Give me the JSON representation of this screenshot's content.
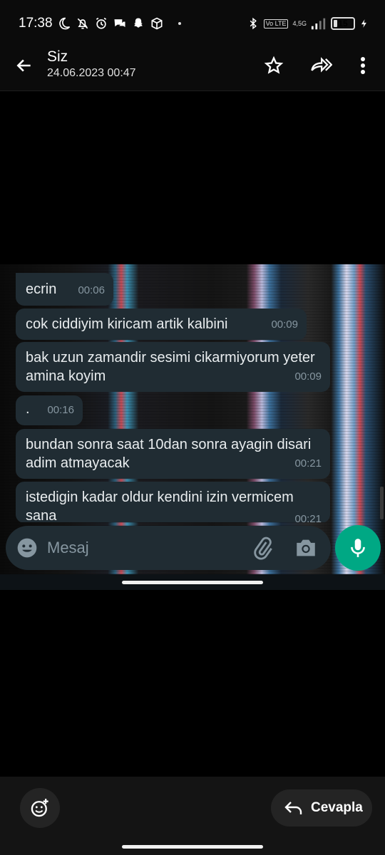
{
  "status_bar": {
    "time": "17:38",
    "battery": "15",
    "volte": "Vo LTE",
    "network": "4,5G"
  },
  "header": {
    "title": "Siz",
    "subtitle": "24.06.2023 00:47"
  },
  "messages": [
    {
      "text": "ecrin",
      "time": "00:06"
    },
    {
      "text": "cok ciddiyim kiricam artik kalbini",
      "time": "00:09"
    },
    {
      "text": "bak uzun zamandir sesimi cikarmiyorum yeter amina koyim",
      "time": "00:09"
    },
    {
      "text": ".",
      "time": "00:16"
    },
    {
      "text": "bundan sonra saat 10dan sonra ayagin disari adim atmayacak",
      "time": "00:21"
    },
    {
      "text": "istedigin kadar oldur kendini izin vermicem sana",
      "time": "00:21"
    }
  ],
  "input": {
    "placeholder": "Mesaj"
  },
  "bottom": {
    "reply_label": "Cevapla"
  },
  "colors": {
    "bubble": "#202c33",
    "accent": "#00a884",
    "timestamp": "#8696a0"
  }
}
